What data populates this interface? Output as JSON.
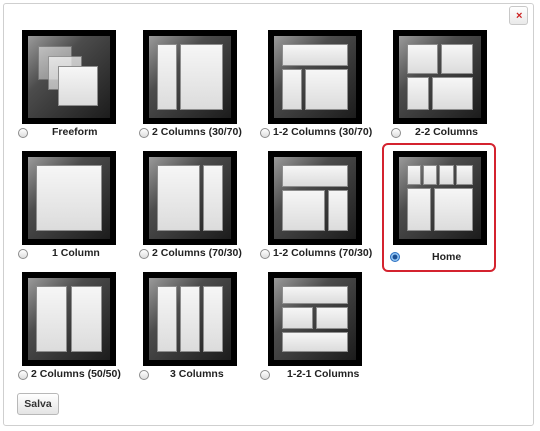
{
  "dialog": {
    "close_label": "×",
    "save_label": "Salva"
  },
  "layouts": [
    {
      "id": "freeform",
      "label": "Freeform",
      "selected": false
    },
    {
      "id": "2-columns-30-70",
      "label": "2 Columns (30/70)",
      "selected": false
    },
    {
      "id": "1-2-columns-30-70",
      "label": "1-2 Columns (30/70)",
      "selected": false
    },
    {
      "id": "2-2-columns",
      "label": "2-2 Columns",
      "selected": false
    },
    {
      "id": "1-column",
      "label": "1 Column",
      "selected": false
    },
    {
      "id": "2-columns-70-30",
      "label": "2 Columns (70/30)",
      "selected": false
    },
    {
      "id": "1-2-columns-70-30",
      "label": "1-2 Columns (70/30)",
      "selected": false
    },
    {
      "id": "home",
      "label": "Home",
      "selected": true
    },
    {
      "id": "2-columns-50-50",
      "label": "2 Columns (50/50)",
      "selected": false
    },
    {
      "id": "3-columns",
      "label": "3 Columns",
      "selected": false
    },
    {
      "id": "1-2-1-columns",
      "label": "1-2-1 Columns",
      "selected": false
    }
  ],
  "colors": {
    "selection_border": "#d4232f",
    "radio_selected": "#2a6fc0",
    "close_icon": "#cc2020"
  }
}
